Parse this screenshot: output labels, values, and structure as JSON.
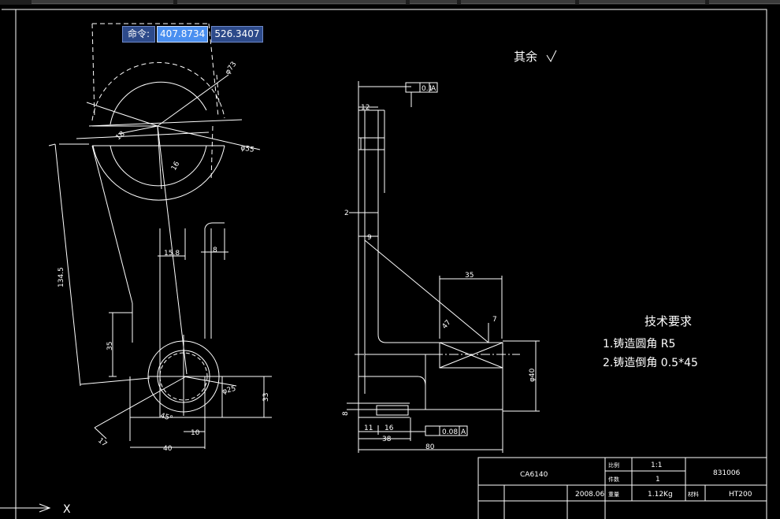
{
  "cad": {
    "command_prompt": {
      "label": "命令:",
      "x_value": "407.8734",
      "y_value": "526.3407"
    },
    "ucs_x_label": "X",
    "surface_note": "其余",
    "tech_requirements": {
      "title": "技术要求",
      "item1": "1.铸造圆角 R5",
      "item2": "2.铸造倒角 0.5*45"
    },
    "dims_left": {
      "r73": "φ73",
      "r55": "φ55",
      "d18": "18",
      "d1345": "134.5",
      "d158": "15.8",
      "d8": "8",
      "d35": "35",
      "d25": "φ25",
      "d33": "33",
      "d45": "45°",
      "d17": "17",
      "d10": "10",
      "d40": "40",
      "d16": "16"
    },
    "dims_right": {
      "gt1": "0.1",
      "gtA": "A",
      "d12": "12",
      "d2": "2",
      "d9": "9",
      "d35": "35",
      "d7": "7",
      "d47": "47",
      "d40": "φ40",
      "d11": "11",
      "d16": "16",
      "d38": "38",
      "d80": "80",
      "d8": "8",
      "gt2": "0.08",
      "gt2A": "A"
    },
    "title_block": {
      "part_name": "CA6140",
      "scale_label": "比例",
      "scale": "1:1",
      "qty_label": "件数",
      "qty": "1",
      "drawing_no": "831006",
      "date": "2008.06",
      "weight_label": "重量",
      "weight": "1.12Kg",
      "material_label": "材料",
      "material": "HT200"
    }
  }
}
